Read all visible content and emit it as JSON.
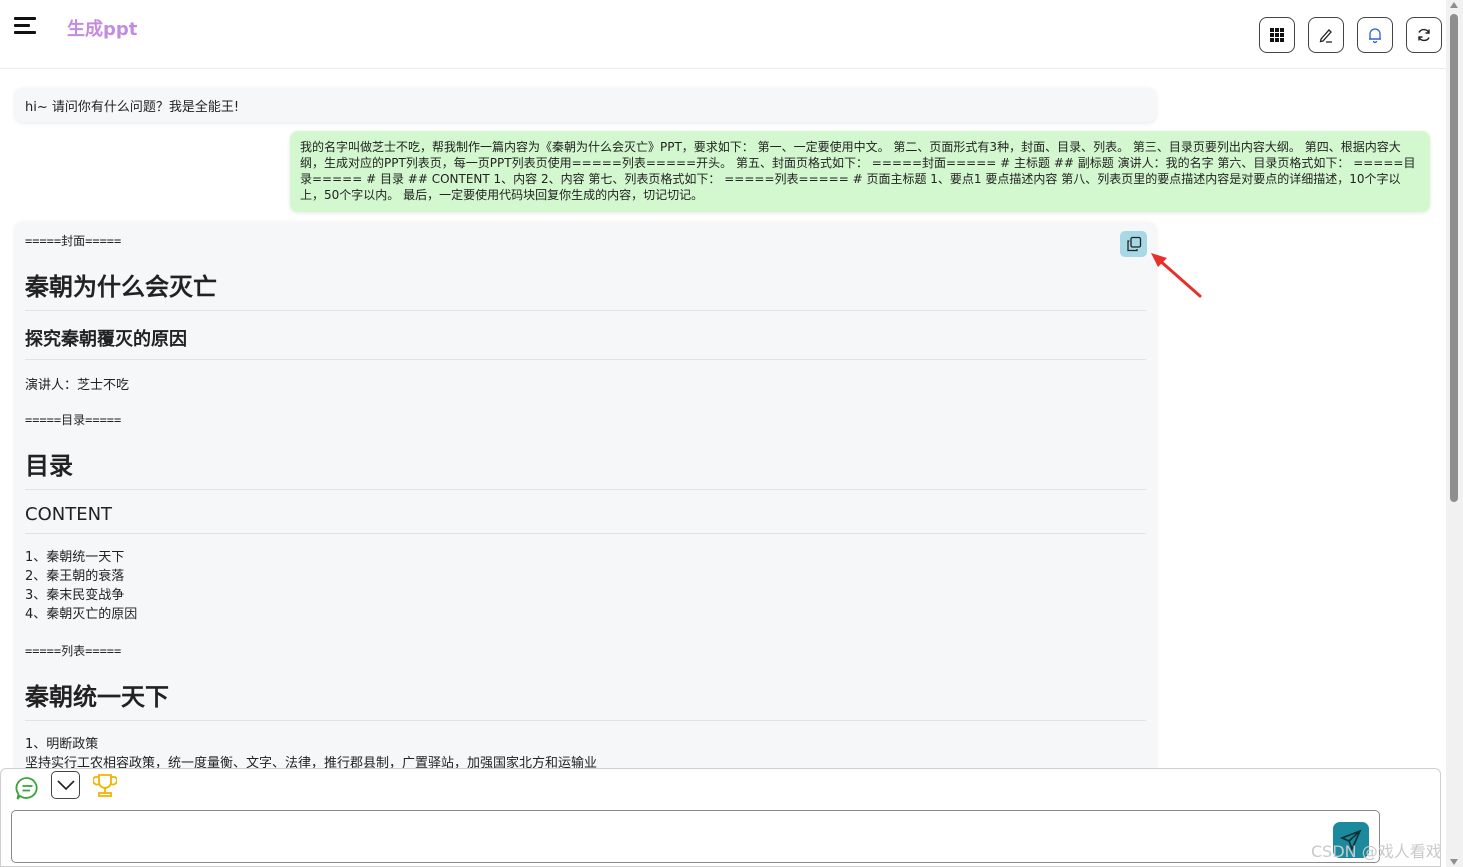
{
  "header": {
    "title": "生成ppt",
    "buttons": [
      {
        "name": "apps-grid-icon"
      },
      {
        "name": "edit-icon"
      },
      {
        "name": "bell-icon"
      },
      {
        "name": "refresh-icon"
      }
    ]
  },
  "messages": {
    "greeting": "hi~ 请问你有什么问题？我是全能王!",
    "user": "我的名字叫做芝士不吃，帮我制作一篇内容为《秦朝为什么会灭亡》PPT，要求如下： 第一、一定要使用中文。 第二、页面形式有3种，封面、目录、列表。 第三、目录页要列出内容大纲。 第四、根据内容大纲，生成对应的PPT列表页，每一页PPT列表页使用=====列表=====开头。 第五、封面页格式如下： =====封面===== # 主标题 ## 副标题 演讲人：我的名字 第六、目录页格式如下： =====目录===== # 目录 ## CONTENT 1、内容 2、内容 第七、列表页格式如下： =====列表===== # 页面主标题 1、要点1 要点描述内容 第八、列表页里的要点描述内容是对要点的详细描述，10个字以上，50个字以内。 最后，一定要使用代码块回复你生成的内容，切记切记。",
    "answer": {
      "cover_marker": "=====封面=====",
      "cover_title": "秦朝为什么会灭亡",
      "cover_subtitle": "探究秦朝覆灭的原因",
      "speaker": "演讲人：芝士不吃",
      "toc_marker": "=====目录=====",
      "toc_title": "目录",
      "toc_subtitle": "CONTENT",
      "toc_items": [
        "1、秦朝统一天下",
        "2、秦王朝的衰落",
        "3、秦末民变战争",
        "4、秦朝灭亡的原因"
      ],
      "list_marker": "=====列表=====",
      "list_title": "秦朝统一天下",
      "list_point": "1、明断政策",
      "list_point_desc": "坚持实行工农相容政策，统一度量衡、文字、法律，推行郡县制，广置驿站，加强国家北方和运输业"
    }
  },
  "input": {
    "placeholder": ""
  },
  "watermark": "CSDN @戏人看戏",
  "colors": {
    "title": "#c48ce0",
    "user_bubble": "#d3f8cf",
    "bot_bubble": "#f6f7f9",
    "copy_button": "#a6d8e6",
    "send_button": "#1a8a9c",
    "annotation_arrow": "#e8302a"
  }
}
